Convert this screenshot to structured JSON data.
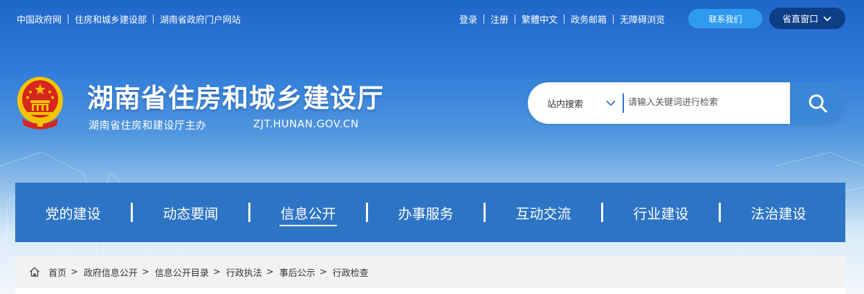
{
  "top_links_left": [
    "中国政府网",
    "住房和城乡建设部",
    "湖南省政府门户网站"
  ],
  "top_links_right": [
    "登录",
    "注册",
    "繁體中文",
    "政务邮箱",
    "无障碍浏览"
  ],
  "contact_button": "联系我们",
  "window_button": "省直窗口",
  "header": {
    "title": "湖南省住房和城乡建设厅",
    "subtitle": "湖南省住房和建设厅主办",
    "domain": "ZJT.HUNAN.GOV.CN"
  },
  "search": {
    "scope": "站内搜索",
    "placeholder": "请输入关键词进行检索",
    "value": ""
  },
  "nav": {
    "items": [
      "党的建设",
      "动态要闻",
      "信息公开",
      "办事服务",
      "互动交流",
      "行业建设",
      "法治建设"
    ],
    "active": "信息公开"
  },
  "breadcrumb": [
    "首页",
    "政府信息公开",
    "信息公开目录",
    "行政执法",
    "事后公示",
    "行政检查"
  ],
  "colors": {
    "nav_bg": "#2d74c5",
    "window_button_bg": "#0e3e86",
    "contact_button_bg": "#2f9bf0",
    "search_button_bg": "#3b86d6",
    "emblem_red": "#d7261e",
    "emblem_gold": "#f5c400"
  },
  "icons": {
    "home": "home-icon",
    "search": "search-icon",
    "dropdown": "chevron-down-icon",
    "window": "chevron-down-icon",
    "emblem": "national-emblem-icon"
  }
}
